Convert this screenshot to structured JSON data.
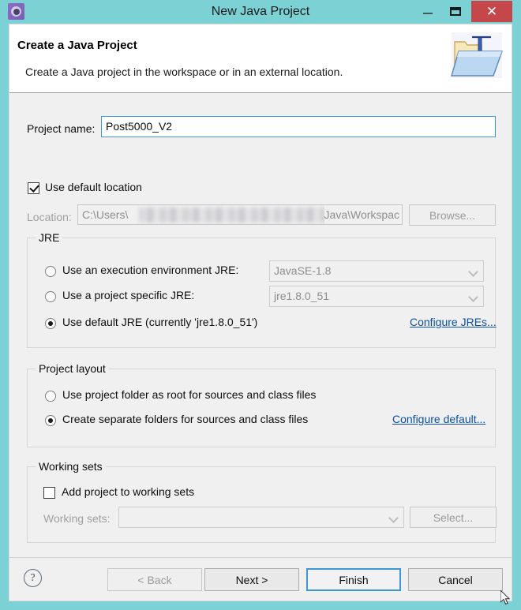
{
  "window": {
    "title": "New Java Project",
    "app_icon": "eclipse-gear-icon",
    "controls": {
      "minimize_label": "—",
      "maximize_label": "",
      "close_label": "✕"
    },
    "frame_color": "#7bd1d4",
    "close_color": "#c5474a"
  },
  "header": {
    "title": "Create a Java Project",
    "description": "Create a Java project in the workspace or in an external location.",
    "banner_icon": "java-project-folder-icon"
  },
  "form": {
    "project_name_label": "Project name:",
    "project_name_value": "Post5000_V2",
    "project_name_placeholder": "",
    "use_default_location_label": "Use default location",
    "use_default_location_checked": true,
    "location_label": "Location:",
    "location_value_prefix": "C:\\Users\\",
    "location_value_suffix": "Java\\Workspac",
    "location_redacted": true,
    "browse_label": "Browse...",
    "browse_enabled": false
  },
  "jre": {
    "group_title": "JRE",
    "options": [
      {
        "label": "Use an execution environment JRE:",
        "selected": false,
        "combo_value": "JavaSE-1.8",
        "combo_enabled": false
      },
      {
        "label": "Use a project specific JRE:",
        "selected": false,
        "combo_value": "jre1.8.0_51",
        "combo_enabled": false
      },
      {
        "label": "Use default JRE (currently 'jre1.8.0_51')",
        "selected": true
      }
    ],
    "configure_link": "Configure JREs..."
  },
  "layout": {
    "group_title": "Project layout",
    "options": [
      {
        "label": "Use project folder as root for sources and class files",
        "selected": false
      },
      {
        "label": "Create separate folders for sources and class files",
        "selected": true
      }
    ],
    "configure_link": "Configure default..."
  },
  "working_sets": {
    "group_title": "Working sets",
    "add_label": "Add project to working sets",
    "add_checked": false,
    "combo_label": "Working sets:",
    "combo_value": "",
    "combo_enabled": false,
    "select_label": "Select...",
    "select_enabled": false
  },
  "buttons": {
    "help_label": "?",
    "back_label": "< Back",
    "back_enabled": false,
    "next_label": "Next >",
    "next_enabled": true,
    "finish_label": "Finish",
    "finish_default": true,
    "cancel_label": "Cancel"
  },
  "colors": {
    "titlebar": "#7bd1d4",
    "close_button": "#c5474a",
    "focus_blue": "#3c97d4",
    "link_blue": "#0b4f9e",
    "dialog_bg": "#f0f0f0",
    "header_bg": "#ffffff"
  }
}
